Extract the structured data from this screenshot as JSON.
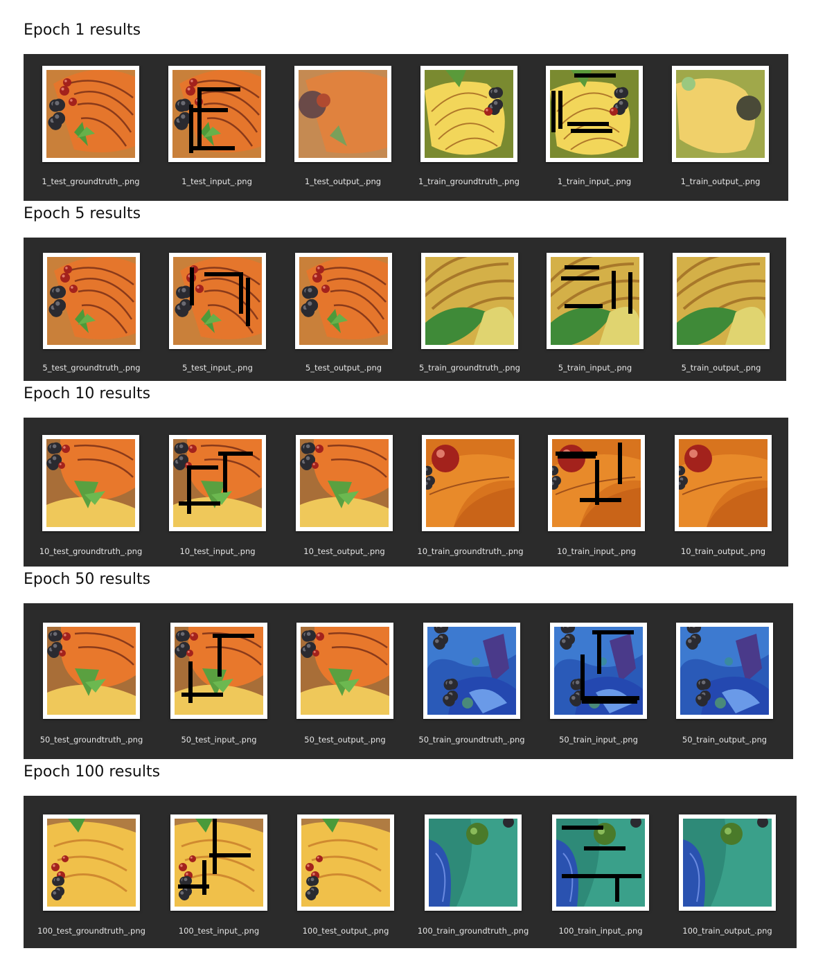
{
  "sections": [
    {
      "title": "Epoch 1 results",
      "files": [
        "1_test_groundtruth_.png",
        "1_test_input_.png",
        "1_test_output_.png",
        "1_train_groundtruth_.png",
        "1_train_input_.png",
        "1_train_output_.png"
      ],
      "themes": [
        "peach-tart",
        "peach-tart",
        "peach-tart-blurry",
        "yellow-fan-tart",
        "yellow-fan-tart",
        "yellow-fan-tart-blurry"
      ],
      "masked": [
        false,
        true,
        false,
        false,
        true,
        false
      ]
    },
    {
      "title": "Epoch 5 results",
      "files": [
        "5_test_groundtruth_.png",
        "5_test_input_.png",
        "5_test_output_.png",
        "5_train_groundtruth_.png",
        "5_train_input_.png",
        "5_train_output_.png"
      ],
      "themes": [
        "peach-tart",
        "peach-tart",
        "peach-tart",
        "yellow-leaf-tart",
        "yellow-leaf-tart",
        "yellow-leaf-tart"
      ],
      "masked": [
        false,
        true,
        false,
        false,
        true,
        false
      ]
    },
    {
      "title": "Epoch 10 results",
      "files": [
        "10_test_groundtruth_.png",
        "10_test_input_.png",
        "10_test_output_.png",
        "10_train_groundtruth_.png",
        "10_train_input_.png",
        "10_train_output_.png"
      ],
      "themes": [
        "peach-tart-leaf",
        "peach-tart-leaf",
        "peach-tart-leaf",
        "orange-cherry",
        "orange-cherry",
        "orange-cherry"
      ],
      "masked": [
        false,
        true,
        false,
        false,
        true,
        false
      ]
    },
    {
      "title": "Epoch 50 results",
      "files": [
        "50_test_groundtruth_.png",
        "50_test_input_.png",
        "50_test_output_.png",
        "50_train_groundtruth_.png",
        "50_train_input_.png",
        "50_train_output_.png"
      ],
      "themes": [
        "peach-tart-leaf",
        "peach-tart-leaf",
        "peach-tart-leaf",
        "blue-berries",
        "blue-berries",
        "blue-berries"
      ],
      "masked": [
        false,
        true,
        false,
        false,
        true,
        false
      ]
    },
    {
      "title": "Epoch 100 results",
      "files": [
        "100_test_groundtruth_.png",
        "100_test_input_.png",
        "100_test_output_.png",
        "100_train_groundtruth_.png",
        "100_train_input_.png",
        "100_train_output_.png"
      ],
      "themes": [
        "yellow-peach-tart",
        "yellow-peach-tart",
        "yellow-peach-tart",
        "teal-green",
        "teal-green",
        "teal-green"
      ],
      "masked": [
        false,
        true,
        false,
        false,
        true,
        false
      ]
    }
  ],
  "colors": {
    "panel_bg": "#2b2b2b",
    "caption_text": "#e6e6e6",
    "mask": "#000000"
  }
}
